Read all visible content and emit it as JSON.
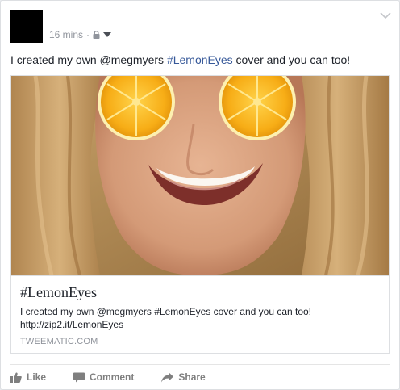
{
  "post": {
    "timestamp": "16 mins",
    "separator": "·",
    "privacy_icon": "lock-icon",
    "status_parts": {
      "before": "I created my own @megmyers ",
      "hashtag": "#LemonEyes",
      "after": " cover and you can too!"
    }
  },
  "link_card": {
    "title": "#LemonEyes",
    "description": "I created my own @megmyers #LemonEyes cover and you can too! http://zip2.it/LemonEyes",
    "domain": "TWEEMATIC.COM"
  },
  "actions": {
    "like_label": "Like",
    "comment_label": "Comment",
    "share_label": "Share"
  },
  "colors": {
    "link_blue": "#365899",
    "meta_gray": "#90949c",
    "action_gray": "#7f7f7f",
    "lemon_yellow": "#f9b31c"
  }
}
